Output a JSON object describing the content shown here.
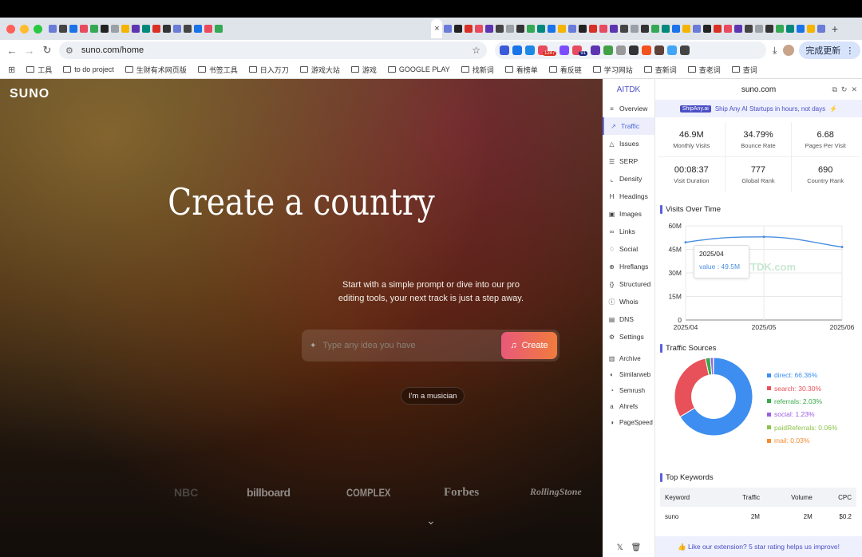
{
  "browser": {
    "active_tab_close": "×",
    "new_tab": "+",
    "back": "←",
    "forward": "→",
    "reload": "↻",
    "url": "suno.com/home",
    "star": "☆",
    "ext_badge_1": "1247",
    "ext_badge_2": "91",
    "update_button": "完成更新",
    "menu": "⋮"
  },
  "bookmarks": [
    "工具",
    "to do project",
    "生财有术网页版",
    "书签工具",
    "日入万刀",
    "游戏大站",
    "游戏",
    "GOOGLE PLAY",
    "找新词",
    "看榜单",
    "看反链",
    "学习网站",
    "查新词",
    "查老词",
    "查词"
  ],
  "suno": {
    "logo": "SUNO",
    "headline": "Create a country",
    "subtext_line1": "Start with a simple prompt or dive into our pro",
    "subtext_line2": "editing tools, your next track is just a step away.",
    "prompt_placeholder": "Type any idea you have",
    "create_button": "Create",
    "musician_button": "I'm a musician",
    "press": [
      "NBC",
      "billboard",
      "COMPLEX",
      "Forbes",
      "RollingStone"
    ],
    "scroll_icon": "⌄"
  },
  "aitdk": {
    "brand": "AITDK",
    "domain": "suno.com",
    "nav": [
      {
        "label": "Overview",
        "icon": "≡"
      },
      {
        "label": "Traffic",
        "icon": "↗"
      },
      {
        "label": "Issues",
        "icon": "△"
      },
      {
        "label": "SERP",
        "icon": "☰"
      },
      {
        "label": "Density",
        "icon": "⌞"
      },
      {
        "label": "Headings",
        "icon": "H"
      },
      {
        "label": "Images",
        "icon": "▣"
      },
      {
        "label": "Links",
        "icon": "∞"
      },
      {
        "label": "Social",
        "icon": "♢"
      },
      {
        "label": "Hreflangs",
        "icon": "⊕"
      },
      {
        "label": "Structured",
        "icon": "{}"
      },
      {
        "label": "Whois",
        "icon": "ⓘ"
      },
      {
        "label": "DNS",
        "icon": "▤"
      },
      {
        "label": "Settings",
        "icon": "⚙"
      }
    ],
    "tools": [
      {
        "label": "Archive",
        "icon": "▥"
      },
      {
        "label": "Similarweb",
        "icon": "◐"
      },
      {
        "label": "Semrush",
        "icon": "◔"
      },
      {
        "label": "Ahrefs",
        "icon": "a"
      },
      {
        "label": "PageSpeed",
        "icon": "◑"
      }
    ],
    "banner_tag": "ShipAny.ai",
    "banner_text": "Ship Any AI Startups in hours, not days",
    "stats": [
      {
        "value": "46.9M",
        "label": "Monthly Visits"
      },
      {
        "value": "34.79%",
        "label": "Bounce Rate"
      },
      {
        "value": "6.68",
        "label": "Pages Per Visit"
      },
      {
        "value": "00:08:37",
        "label": "Visit Duration"
      },
      {
        "value": "777",
        "label": "Global Rank"
      },
      {
        "value": "690",
        "label": "Country Rank"
      }
    ],
    "visits_title": "Visits Over Time",
    "sources_title": "Traffic Sources",
    "keywords_title": "Top Keywords",
    "tooltip_date": "2025/04",
    "tooltip_value": "value : 49.5M",
    "watermark": "AITDK.com",
    "keywords": {
      "headers": [
        "Keyword",
        "Traffic",
        "Volume",
        "CPC"
      ],
      "rows": [
        [
          "suno",
          "2M",
          "2M",
          "$0.2"
        ]
      ]
    },
    "footer": "👍 Like our extension? 5 star rating helps us improve!",
    "accent": "#5a5fe0"
  },
  "chart_data": [
    {
      "type": "line",
      "title": "Visits Over Time",
      "x": [
        "2025/04",
        "2025/05",
        "2025/06"
      ],
      "series": [
        {
          "values": [
            49.5,
            53.0,
            46.5
          ]
        }
      ],
      "ylim": [
        0,
        60
      ],
      "yticks": [
        "0",
        "15M",
        "30M",
        "45M",
        "60M"
      ],
      "grid": true,
      "color": "#4a8fe0"
    },
    {
      "type": "pie",
      "title": "Traffic Sources",
      "labels": [
        "direct",
        "search",
        "referrals",
        "social",
        "paidReferrals",
        "mail"
      ],
      "values": [
        66.36,
        30.3,
        2.03,
        1.23,
        0.06,
        0.03
      ],
      "display": [
        "direct: 66.36%",
        "search: 30.30%",
        "referrals: 2.03%",
        "social: 1.23%",
        "paidReferrals: 0.06%",
        "mail: 0.03%"
      ],
      "colors": [
        "#3d8ef0",
        "#e8515a",
        "#3aa84a",
        "#9b5de5",
        "#8bc34a",
        "#f28b30"
      ],
      "legend": "right"
    }
  ]
}
